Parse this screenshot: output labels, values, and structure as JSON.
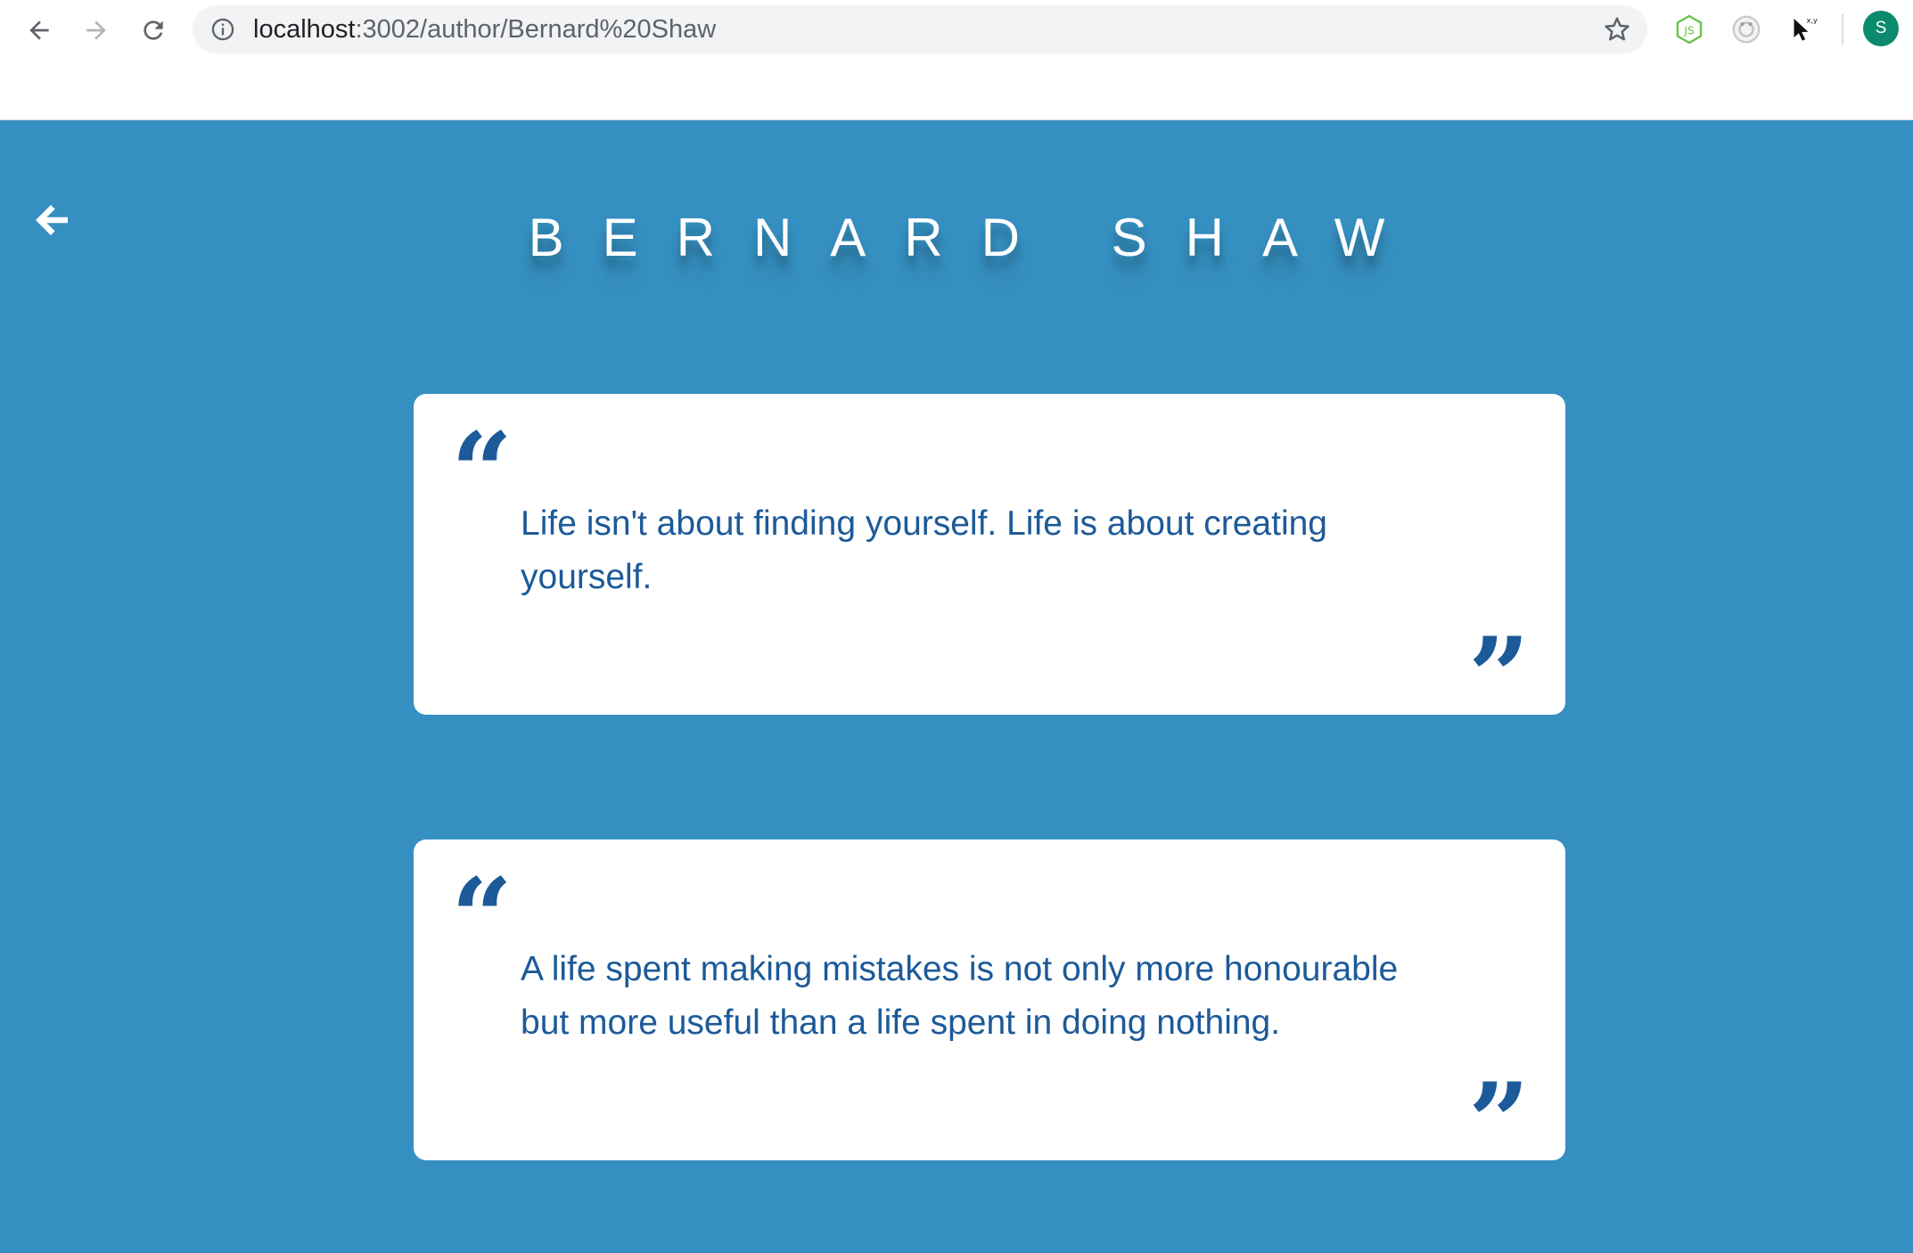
{
  "browser": {
    "url_host": "localhost",
    "url_path": ":3002/author/Bernard%20Shaw",
    "icons": {
      "back": "arrow-left-icon",
      "forward": "arrow-right-icon",
      "reload": "reload-icon",
      "info": "info-icon",
      "bookmark": "star-icon",
      "ext_node": "nodejs-icon",
      "ext_2": "extension-icon",
      "ext_3": "cursor-xy-icon"
    },
    "ext_cursor_label": "x,y",
    "profile_initial": "S",
    "profile_color": "#0b8a6e"
  },
  "page": {
    "background_color": "#3590c1",
    "author_name": "BERNARD SHAW",
    "back_icon": "arrow-left-icon",
    "quotes": [
      {
        "open_mark": "“",
        "text": "Life isn't about finding yourself. Life is about creating yourself.",
        "close_mark": "”"
      },
      {
        "open_mark": "“",
        "text": "A life spent making mistakes is not only more honourable but more useful than a life spent in doing nothing.",
        "close_mark": "”"
      }
    ],
    "quote_color": "#1c5a99"
  }
}
